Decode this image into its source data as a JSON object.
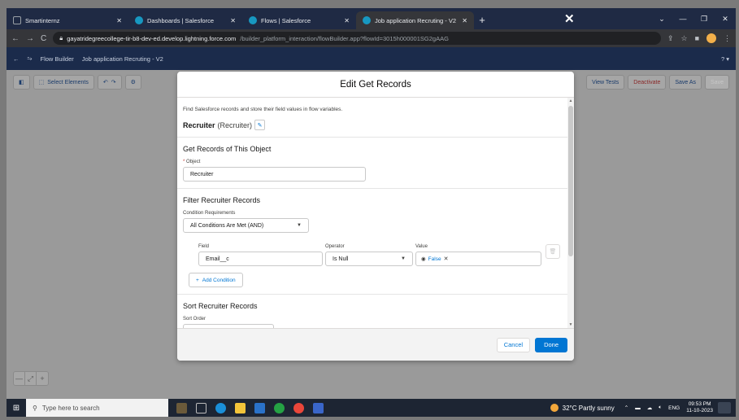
{
  "browser": {
    "tabs": [
      {
        "title": "Smartinternz",
        "active": false
      },
      {
        "title": "Dashboards | Salesforce",
        "active": false
      },
      {
        "title": "Flows | Salesforce",
        "active": false
      },
      {
        "title": "Job application Recruting - V2",
        "active": true
      }
    ],
    "url_host": "gayatridegreecollege-tir-b8-dev-ed.develop.lightning.force.com",
    "url_path": "/builder_platform_interaction/flowBuilder.app?flowId=3015h000001SG2gAAG"
  },
  "flow_builder": {
    "app_name": "Flow Builder",
    "flow_name": "Job application Recruting - V2",
    "help": "? ▾",
    "toolbar": {
      "select_elements": "Select Elements",
      "view_tests": "View Tests",
      "deactivate": "Deactivate",
      "save_as": "Save As",
      "save": "Save"
    }
  },
  "modal": {
    "title": "Edit Get Records",
    "description": "Find Salesforce records and store their field values in flow variables.",
    "element_label": "Recruiter",
    "element_api": "(Recruiter)",
    "object_section": {
      "title": "Get Records of This Object",
      "object_label": "Object",
      "object_value": "Recruiter"
    },
    "filter_section": {
      "title": "Filter Recruiter Records",
      "condition_req_label": "Condition Requirements",
      "condition_req_value": "All Conditions Are Met (AND)",
      "field_header": "Field",
      "operator_header": "Operator",
      "value_header": "Value",
      "condition": {
        "field": "Email__c",
        "operator": "Is Null",
        "value": "False"
      },
      "add_condition": "Add Condition"
    },
    "sort_section": {
      "title": "Sort Recruiter Records",
      "sort_order_label": "Sort Order"
    },
    "cancel": "Cancel",
    "done": "Done"
  },
  "taskbar": {
    "search_placeholder": "Type here to search",
    "weather": "32°C  Partly sunny",
    "lang": "ENG",
    "time": "09:53 PM",
    "date": "11-10-2023"
  },
  "colors": {
    "brand": "#0176d3",
    "fb_header": "#1b2b4b"
  }
}
